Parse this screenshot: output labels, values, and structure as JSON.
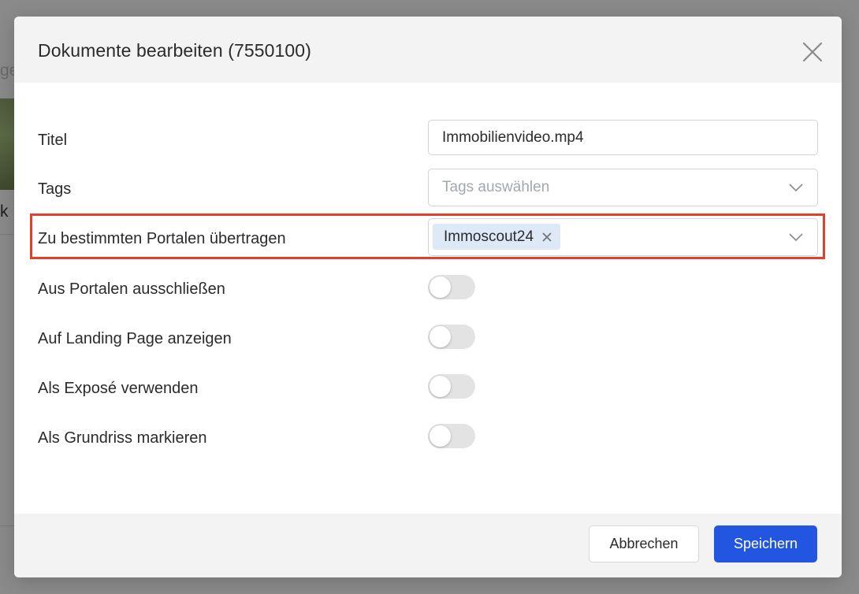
{
  "background": {
    "fragment_top": "ge",
    "fragment_mid": "k"
  },
  "modal": {
    "title": "Dokumente bearbeiten (7550100)",
    "close_icon": "close-icon"
  },
  "form": {
    "title_label": "Titel",
    "title_value": "Immobilienvideo.mp4",
    "tags_label": "Tags",
    "tags_placeholder": "Tags auswählen",
    "portals_label": "Zu bestimmten Portalen übertragen",
    "portals_selected": [
      "Immoscout24"
    ],
    "exclude_portals_label": "Aus Portalen ausschließen",
    "exclude_portals_on": false,
    "landing_page_label": "Auf Landing Page anzeigen",
    "landing_page_on": false,
    "expose_label": "Als Exposé verwenden",
    "expose_on": false,
    "floorplan_label": "Als Grundriss markieren",
    "floorplan_on": false
  },
  "footer": {
    "cancel_label": "Abbrechen",
    "save_label": "Speichern"
  },
  "colors": {
    "primary": "#2356e0",
    "highlight": "#e0412a",
    "chip_bg": "#dde9f7",
    "toggle_off": "#e3e3e3"
  }
}
